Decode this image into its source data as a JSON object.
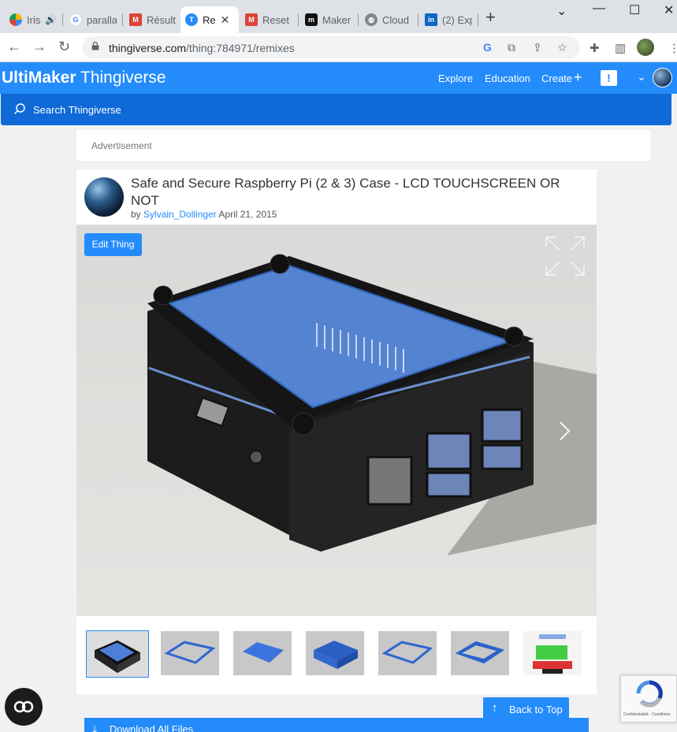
{
  "browser": {
    "tabs": [
      {
        "title": "Iris",
        "favicon": "iris-icon",
        "has_audio": true
      },
      {
        "title": "paralla",
        "favicon": "google-icon"
      },
      {
        "title": "Résult",
        "favicon": "gmail-icon"
      },
      {
        "title": "Re",
        "favicon": "thingiverse-icon",
        "active": true
      },
      {
        "title": "Reset",
        "favicon": "gmail-icon"
      },
      {
        "title": "Maker",
        "favicon": "makerworld-icon"
      },
      {
        "title": "Cloud",
        "favicon": "globe-icon"
      },
      {
        "title": "(2) Exp",
        "favicon": "linkedin-icon"
      }
    ],
    "url_domain": "thingiverse.com",
    "url_path": "/thing:784971/remixes"
  },
  "header": {
    "brand_bold": "UltiMaker",
    "brand_light": "Thingiverse",
    "nav": [
      "Explore",
      "Education",
      "Create"
    ],
    "alert": "!"
  },
  "search": {
    "placeholder": "Search Thingiverse"
  },
  "ad": {
    "label": "Advertisement"
  },
  "thing": {
    "title": "Safe and Secure Raspberry Pi (2 & 3) Case - LCD TOUCHSCREEN OR NOT",
    "by": "by",
    "author": "Sylvain_Dollinger",
    "date": "April 21, 2015",
    "edit_label": "Edit Thing",
    "thumbnail_count": 7
  },
  "actions": {
    "download_all": "Download All Files",
    "back_to_top": "Back to Top"
  },
  "recaptcha": {
    "text": "Confidentialité - Conditions"
  },
  "colors": {
    "brand_blue": "#248bfb",
    "search_blue": "#0f69d6",
    "page_bg": "#f1f1f1"
  }
}
